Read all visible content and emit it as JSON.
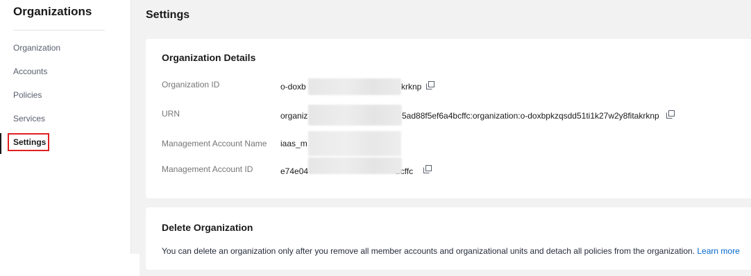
{
  "sidebar": {
    "title": "Organizations",
    "items": [
      {
        "label": "Organization"
      },
      {
        "label": "Accounts"
      },
      {
        "label": "Policies"
      },
      {
        "label": "Services"
      },
      {
        "label": "Settings"
      }
    ],
    "active_item": "Settings"
  },
  "page": {
    "title": "Settings"
  },
  "details": {
    "heading": "Organization Details",
    "org_id_label": "Organization ID",
    "org_id_prefix": "o-doxb",
    "org_id_suffix": "krknp",
    "urn_label": "URN",
    "urn_prefix": "organiz",
    "urn_suffix": "5ad88f5ef6a4bcffc:organization:o-doxbpkzqsdd51ti1k27w2y8fitakrknp",
    "mgmt_name_label": "Management Account Name",
    "mgmt_name_prefix": "iaas_m",
    "mgmt_id_label": "Management Account ID",
    "mgmt_id_prefix": "e74e04",
    "mgmt_id_suffix": "bcffc"
  },
  "delete": {
    "heading": "Delete Organization",
    "description": "You can delete an organization only after you remove all member accounts and organizational units and detach all policies from the organization.",
    "link_label": "Learn more"
  },
  "colors": {
    "accent_link": "#0066cc",
    "highlight": "#e02020"
  }
}
